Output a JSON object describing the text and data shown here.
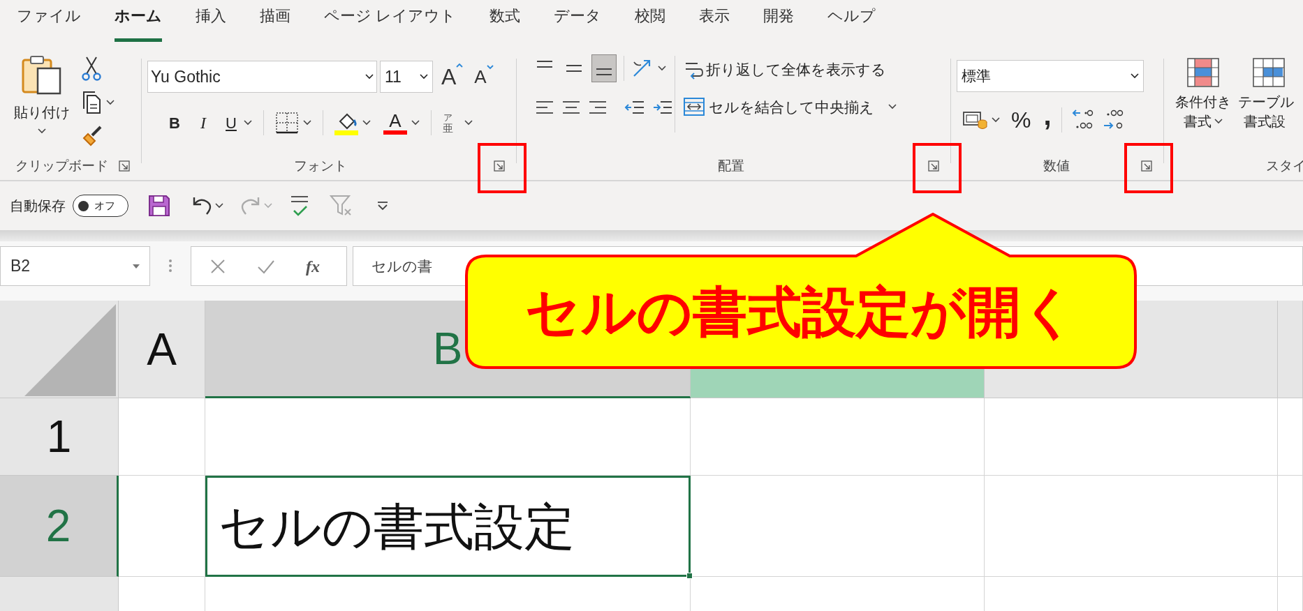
{
  "tabs": [
    {
      "label": "ファイル",
      "selected": false
    },
    {
      "label": "ホーム",
      "selected": true
    },
    {
      "label": "挿入",
      "selected": false
    },
    {
      "label": "描画",
      "selected": false
    },
    {
      "label": "ページ レイアウト",
      "selected": false
    },
    {
      "label": "数式",
      "selected": false
    },
    {
      "label": "データ",
      "selected": false
    },
    {
      "label": "校閲",
      "selected": false
    },
    {
      "label": "表示",
      "selected": false
    },
    {
      "label": "開発",
      "selected": false
    },
    {
      "label": "ヘルプ",
      "selected": false
    }
  ],
  "ribbon": {
    "clipboard": {
      "paste": "貼り付け",
      "label": "クリップボード"
    },
    "font": {
      "name": "Yu Gothic",
      "size": "11",
      "grow": "A",
      "shrink": "A",
      "bold": "B",
      "italic": "I",
      "underline": "U",
      "font_color": "A",
      "phonetic_top": "ア",
      "phonetic_bottom": "亜",
      "label": "フォント"
    },
    "alignment": {
      "vertical": [
        {
          "selected": false
        },
        {
          "selected": false
        },
        {
          "selected": true
        }
      ],
      "wrap_text": "折り返して全体を表示する",
      "merge_center": "セルを結合して中央揃え",
      "label": "配置"
    },
    "number": {
      "format": "標準",
      "percent": "%",
      "comma": ",",
      "label": "数値"
    },
    "styles": {
      "conditional_top": "条件付き",
      "conditional_bottom": "書式",
      "table_top": "テーブル",
      "table_bottom": "書式設",
      "label": "スタイ"
    }
  },
  "quick_access": {
    "autosave_label": "自動保存",
    "autosave_state": "オフ",
    "autosave_on": false,
    "redo_disabled": true
  },
  "formula_bar": {
    "name_box": "B2",
    "function_label": "fx",
    "formula": "セルの書"
  },
  "grid": {
    "columns": [
      {
        "label": "A",
        "selected": false,
        "highlighted": false
      },
      {
        "label": "B",
        "selected": true,
        "highlighted": false
      },
      {
        "selected": false,
        "highlighted": true
      },
      {
        "selected": false,
        "highlighted": false
      },
      {
        "selected": false,
        "highlighted": false
      }
    ],
    "rows": [
      {
        "label": "1",
        "selected": false
      },
      {
        "label": "2",
        "selected": true,
        "cell_b": {
          "text": "セルの書式設定",
          "active": true
        }
      },
      {
        "selected": false
      }
    ]
  },
  "callout": {
    "text": "セルの書式設定が開く"
  }
}
